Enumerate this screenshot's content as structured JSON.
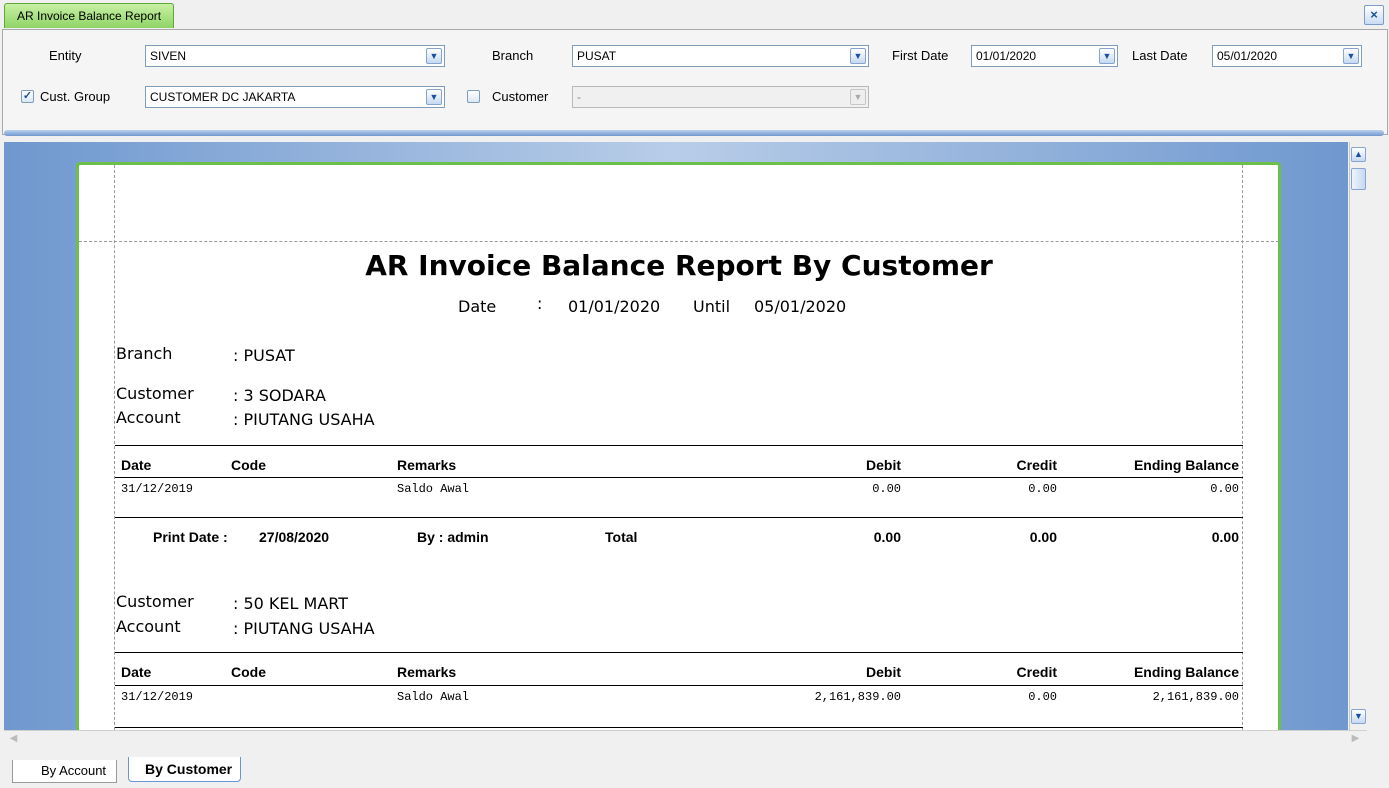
{
  "window": {
    "doc_tab": "AR Invoice Balance Report",
    "close": "×"
  },
  "filters": {
    "entity_label": "Entity",
    "entity_value": "SIVEN",
    "branch_label": "Branch",
    "branch_value": "PUSAT",
    "first_date_label": "First Date",
    "first_date_value": "01/01/2020",
    "last_date_label": "Last Date",
    "last_date_value": "05/01/2020",
    "cust_group_checked": true,
    "cust_group_label": "Cust. Group",
    "cust_group_value": "CUSTOMER DC JAKARTA",
    "customer_checked": false,
    "customer_label": "Customer",
    "customer_value": "-"
  },
  "report": {
    "title": "AR Invoice Balance Report By Customer",
    "date_label": "Date",
    "colon": ":",
    "date_from": "01/01/2020",
    "until_label": "Until",
    "date_to": "05/01/2020",
    "branch_label": "Branch",
    "branch_value": ": PUSAT",
    "columns": {
      "date": "Date",
      "code": "Code",
      "remarks": "Remarks",
      "debit": "Debit",
      "credit": "Credit",
      "ending": "Ending Balance"
    },
    "customer_label": "Customer",
    "account_label": "Account",
    "groups": [
      {
        "customer": ": 3 SODARA",
        "account": ": PIUTANG USAHA",
        "rows": [
          {
            "date": "31/12/2019",
            "code": "",
            "remarks": "Saldo Awal",
            "debit": "0.00",
            "credit": "0.00",
            "ending": "0.00"
          }
        ],
        "footer": {
          "print_date_label": "Print Date :",
          "print_date": "27/08/2020",
          "by": "By : admin",
          "total_label": "Total",
          "debit": "0.00",
          "credit": "0.00",
          "ending": "0.00"
        }
      },
      {
        "customer": ": 50 KEL MART",
        "account": ": PIUTANG USAHA",
        "rows": [
          {
            "date": "31/12/2019",
            "code": "",
            "remarks": "Saldo Awal",
            "debit": "2,161,839.00",
            "credit": "0.00",
            "ending": "2,161,839.00"
          }
        ]
      }
    ]
  },
  "bottom_tabs": [
    {
      "label": "By Account",
      "active": false
    },
    {
      "label": "By Customer",
      "active": true
    }
  ],
  "icons": {
    "dropdown": "chevron-down-icon",
    "check": "check-icon",
    "scroll_up": "arrow-up-icon",
    "scroll_down": "arrow-down-icon"
  },
  "colors": {
    "tab_green": "#8fd466",
    "page_border": "#6cc04a",
    "preview_bg": "#6f98cf"
  }
}
